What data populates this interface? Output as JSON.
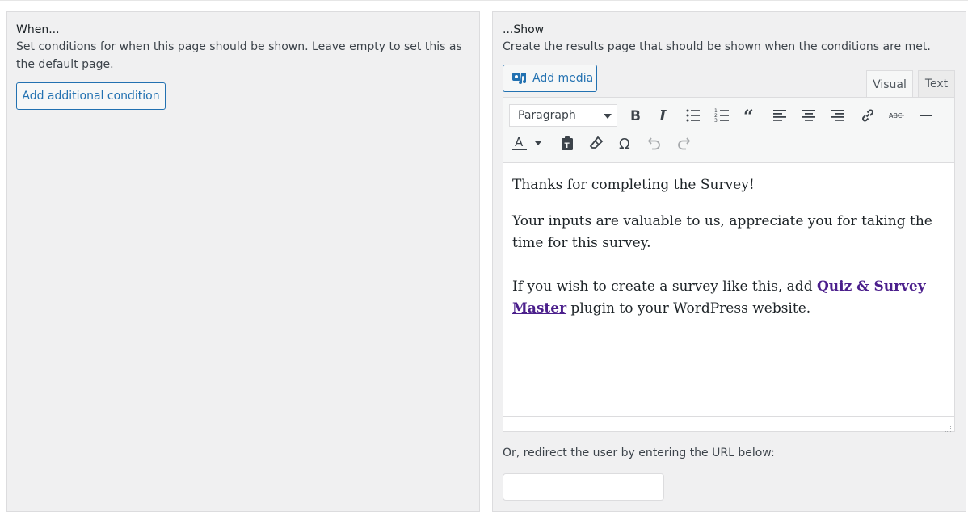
{
  "when": {
    "heading": "When...",
    "description": "Set conditions for when this page should be shown. Leave empty to set this as the default page.",
    "add_condition_label": "Add additional condition"
  },
  "show": {
    "heading": "...Show",
    "description": "Create the results page that should be shown when the conditions are met.",
    "add_media_label": "Add media",
    "tabs": {
      "visual": "Visual",
      "text": "Text"
    },
    "format_select": "Paragraph",
    "content": {
      "line1": "Thanks for completing the Survey!",
      "line2": "Your inputs are valuable to us, appreciate you for taking the time for this survey.",
      "line3_pre": "If you wish to create a survey like this, add ",
      "line3_link": "Quiz & Survey Master",
      "line3_post": " plugin to your WordPress website."
    },
    "redirect_label": "Or, redirect the user by entering the URL below:",
    "redirect_value": ""
  },
  "colors": {
    "accent": "#2271b1",
    "link": "#4b1f8c",
    "panel": "#f0f0f1"
  },
  "toolbar_icons": [
    "bold-icon",
    "italic-icon",
    "bullet-list-icon",
    "numbered-list-icon",
    "blockquote-icon",
    "align-left-icon",
    "align-center-icon",
    "align-right-icon",
    "link-icon",
    "strikethrough-icon",
    "horizontal-line-icon",
    "text-color-icon",
    "paste-text-icon",
    "clear-formatting-icon",
    "special-character-icon",
    "undo-icon",
    "redo-icon"
  ]
}
